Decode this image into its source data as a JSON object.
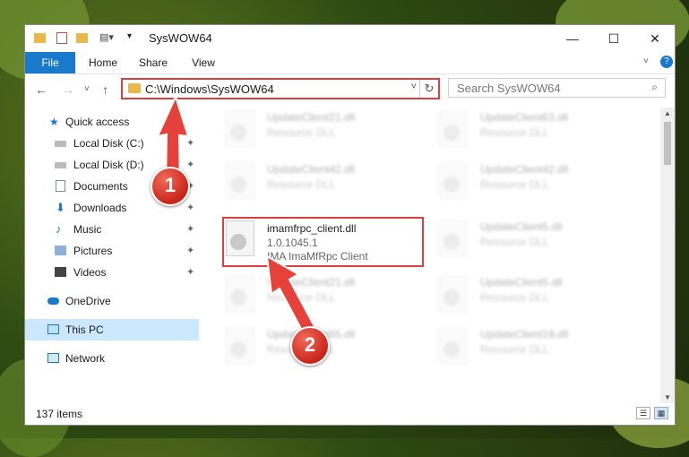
{
  "window": {
    "title": "SysWOW64",
    "controls": {
      "minimize": "—",
      "maximize": "☐",
      "close": "✕"
    }
  },
  "ribbon": {
    "tabs": [
      "File",
      "Home",
      "Share",
      "View"
    ],
    "expand_icon": "chevron-down-icon",
    "help_icon": "help-icon"
  },
  "navigation": {
    "back": "←",
    "forward": "→",
    "recent": "˅",
    "up": "↑"
  },
  "address": {
    "path": "C:\\Windows\\SysWOW64",
    "dropdown": "˅",
    "refresh": "↻"
  },
  "search": {
    "placeholder": "Search SysWOW64",
    "icon": "⌕"
  },
  "sidebar": {
    "items": [
      {
        "label": "Quick access",
        "icon": "star-icon",
        "pinned": false
      },
      {
        "label": "Local Disk (C:)",
        "icon": "drive-icon",
        "pinned": true
      },
      {
        "label": "Local Disk (D:)",
        "icon": "drive-icon",
        "pinned": true
      },
      {
        "label": "Documents",
        "icon": "documents-icon",
        "pinned": true
      },
      {
        "label": "Downloads",
        "icon": "download-icon",
        "pinned": true
      },
      {
        "label": "Music",
        "icon": "music-icon",
        "pinned": true
      },
      {
        "label": "Pictures",
        "icon": "pictures-icon",
        "pinned": true
      },
      {
        "label": "Videos",
        "icon": "videos-icon",
        "pinned": true
      },
      {
        "label": "OneDrive",
        "icon": "cloud-icon",
        "pinned": false
      },
      {
        "label": "This PC",
        "icon": "computer-icon",
        "pinned": false
      },
      {
        "label": "Network",
        "icon": "network-icon",
        "pinned": false
      }
    ],
    "pin_glyph": "📌"
  },
  "files": [
    {
      "name": "UpdateClient21.dll",
      "desc": "Resource DLL",
      "blurred": true
    },
    {
      "name": "UpdateClient63.dll",
      "desc": "Resource DLL",
      "blurred": true
    },
    {
      "name": "UpdateClient42.dll",
      "desc": "Resource DLL",
      "blurred": true
    },
    {
      "name": "UpdateClient42.dll",
      "desc": "Resource DLL",
      "blurred": true
    },
    {
      "name": "imamfrpc_client.dll",
      "desc": "1.0.1045.1",
      "desc2": "IMA ImaMfRpc Client",
      "blurred": false
    },
    {
      "name": "UpdateClient5.dll",
      "desc": "Resource DLL",
      "blurred": true
    },
    {
      "name": "UpdateClient21.dll",
      "desc": "Resource DLL",
      "blurred": true
    },
    {
      "name": "UpdateClient5.dll",
      "desc": "Resource DLL",
      "blurred": true
    },
    {
      "name": "UpdateClient65.dll",
      "desc": "Resource DLL",
      "blurred": true
    },
    {
      "name": "UpdateClient19.dll",
      "desc": "Resource DLL",
      "blurred": true
    }
  ],
  "status": {
    "item_count": "137 items"
  },
  "callouts": [
    "1",
    "2"
  ],
  "colors": {
    "accent": "#1979ca",
    "highlight": "#d94040",
    "selected": "#cce8ff"
  }
}
